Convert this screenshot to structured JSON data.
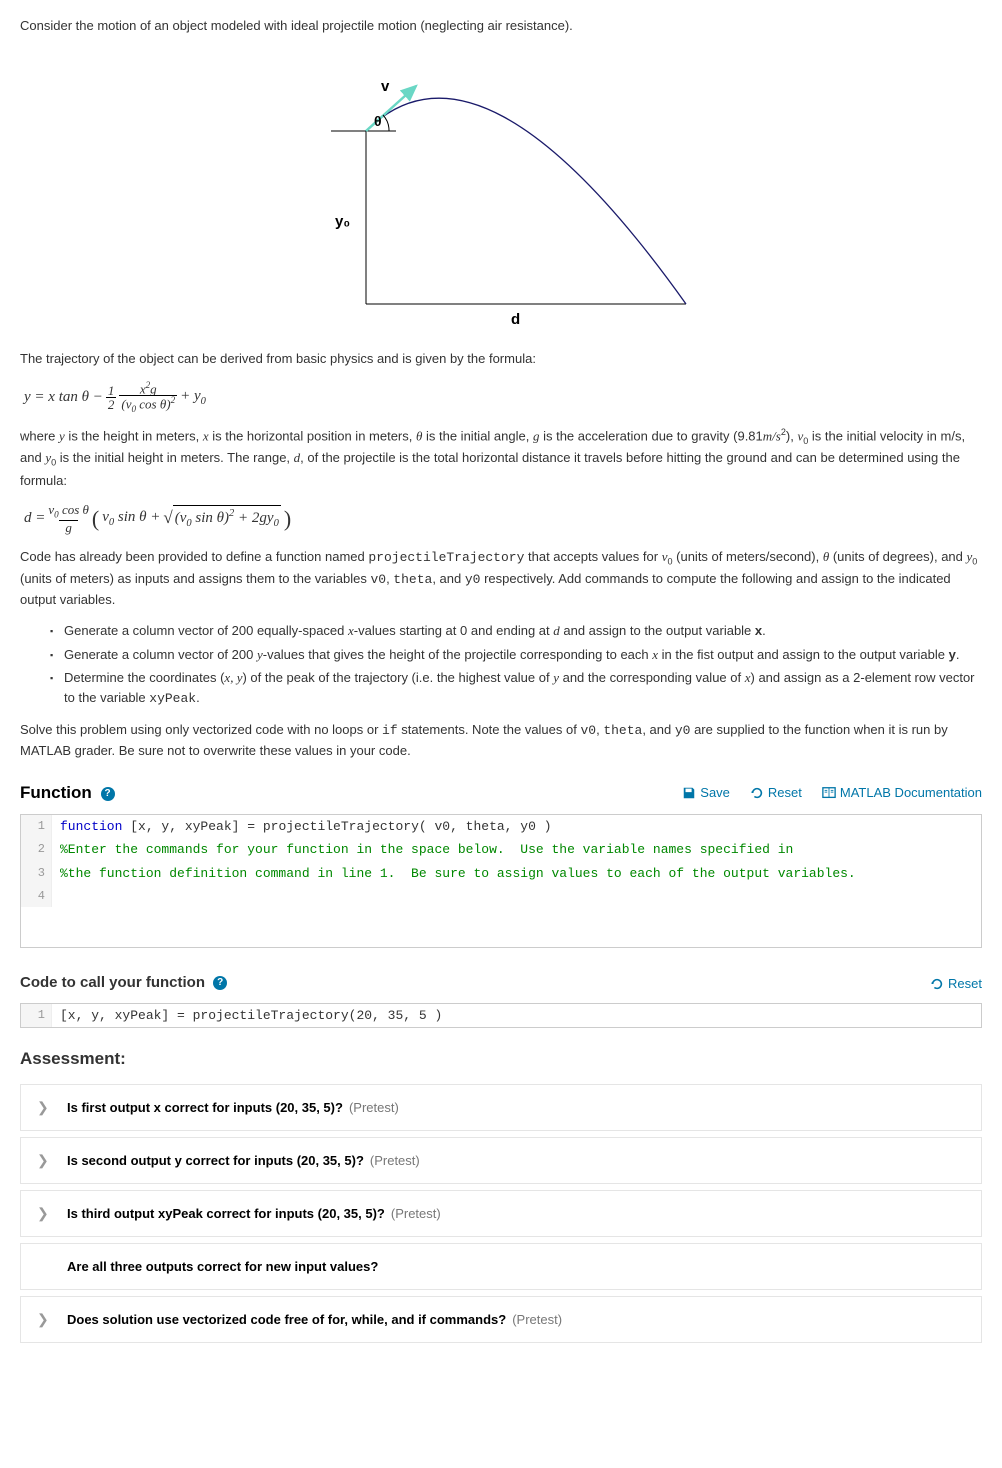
{
  "intro": "Consider the motion of an object modeled with ideal projectile motion (neglecting air resistance).",
  "diagram": {
    "v_label": "v",
    "theta_label": "θ",
    "y0_label": "y₀",
    "d_label": "d"
  },
  "para1": "The trajectory of the object can be derived from basic physics and is given by the formula:",
  "formula1_html": "y = x tan θ − (1/2) · x²g / (v₀ cos θ)² + y₀",
  "para2_html": "where <span class='serif-ital'>y</span> is the height in meters, <span class='serif-ital'>x</span> is the horizontal position in meters, <span class='serif-ital'>θ</span> is the initial angle, <span class='serif-ital'>g</span> is the acceleration due to gravity (9.81<span class='serif-ital'>m/s</span><span class='sup'>2</span>), <span class='serif-ital'>v</span><span class='sub'>0</span> is the initial velocity in m/s, and <span class='serif-ital'>y</span><span class='sub'>0</span> is the initial height in meters. The range, <span class='serif-ital'>d</span>, of the projectile is the total horizontal distance it travels before hitting the ground and can be determined using the formula:",
  "formula2_html": "d = (v₀ cos θ / g) · ( v₀ sin θ + √( (v₀ sin θ)² + 2gy₀ ) )",
  "para3_html": "Code has already been provided to define a function named <span class='mono'>projectileTrajectory</span> that accepts values for <span class='serif-ital'>v</span><span class='sub'>0</span> (units of meters/second), <span class='serif-ital'>θ</span> (units of degrees), and <span class='serif-ital'>y</span><span class='sub'>0</span> (units of meters) as inputs and assigns them to the variables <span class='mono'>v0</span>, <span class='mono'>theta</span>, and <span class='mono'>y0</span> respectively.  Add commands to compute the following and assign to the indicated output variables.",
  "bullets": [
    "Generate a column vector of 200 equally-spaced <span class='serif-ital'>x</span>-values starting at 0 and ending at <span class='serif-ital'>d</span> and assign to the output variable <b>x</b>.",
    "Generate a column vector of 200 <span class='serif-ital'>y</span>-values that gives the height of the projectile corresponding to each <span class='serif-ital'>x</span> in the fist output and assign to the output variable <b>y</b>.",
    "Determine the coordinates (<span class='serif-ital'>x, y</span>) of the peak of the trajectory (i.e. the highest value of <span class='serif-ital'>y</span> and the corresponding value of <span class='serif-ital'>x</span>) and assign as a 2-element row vector to the variable <span class='mono'>xyPeak</span>."
  ],
  "para4_html": "Solve this problem using only vectorized code with no loops or <span class='mono'>if</span> statements.  Note the values of <span class='mono'>v0</span>, <span class='mono'>theta</span>, and <span class='mono'>y0</span> are supplied to the function when it is run by MATLAB grader.  Be sure not to overwrite these values in your code.",
  "function_header": "Function",
  "toolbar": {
    "save": "Save",
    "reset": "Reset",
    "docs": "MATLAB Documentation"
  },
  "code_lines": [
    {
      "n": "1",
      "html": "<span class='kw'>function</span> [x, y, xyPeak] = projectileTrajectory( v0, theta, y0 )"
    },
    {
      "n": "2",
      "html": "<span class='cmt'>%Enter the commands for your function in the space below.  Use the variable names specified in</span>"
    },
    {
      "n": "3",
      "html": "<span class='cmt'>%the function definition command in line 1.  Be sure to assign values to each of the output variables.</span>"
    },
    {
      "n": "4",
      "html": ""
    }
  ],
  "call_header": "Code to call your function",
  "call_lines": [
    {
      "n": "1",
      "html": "[x, y, xyPeak] = projectileTrajectory(20, 35, 5 )"
    }
  ],
  "assessment_header": "Assessment:",
  "assessments": [
    {
      "label": "Is first output x correct for inputs (20, 35, 5)?",
      "pretest": "(Pretest)",
      "chev": true
    },
    {
      "label": "Is second output y correct for inputs (20, 35, 5)?",
      "pretest": "(Pretest)",
      "chev": true
    },
    {
      "label": "Is third output xyPeak correct for inputs (20, 35, 5)?",
      "pretest": "(Pretest)",
      "chev": true
    },
    {
      "label": "Are all three outputs correct for new input values?",
      "pretest": "",
      "chev": false
    },
    {
      "label": "Does solution use vectorized code free of for, while, and if commands?",
      "pretest": "(Pretest)",
      "chev": true
    }
  ]
}
